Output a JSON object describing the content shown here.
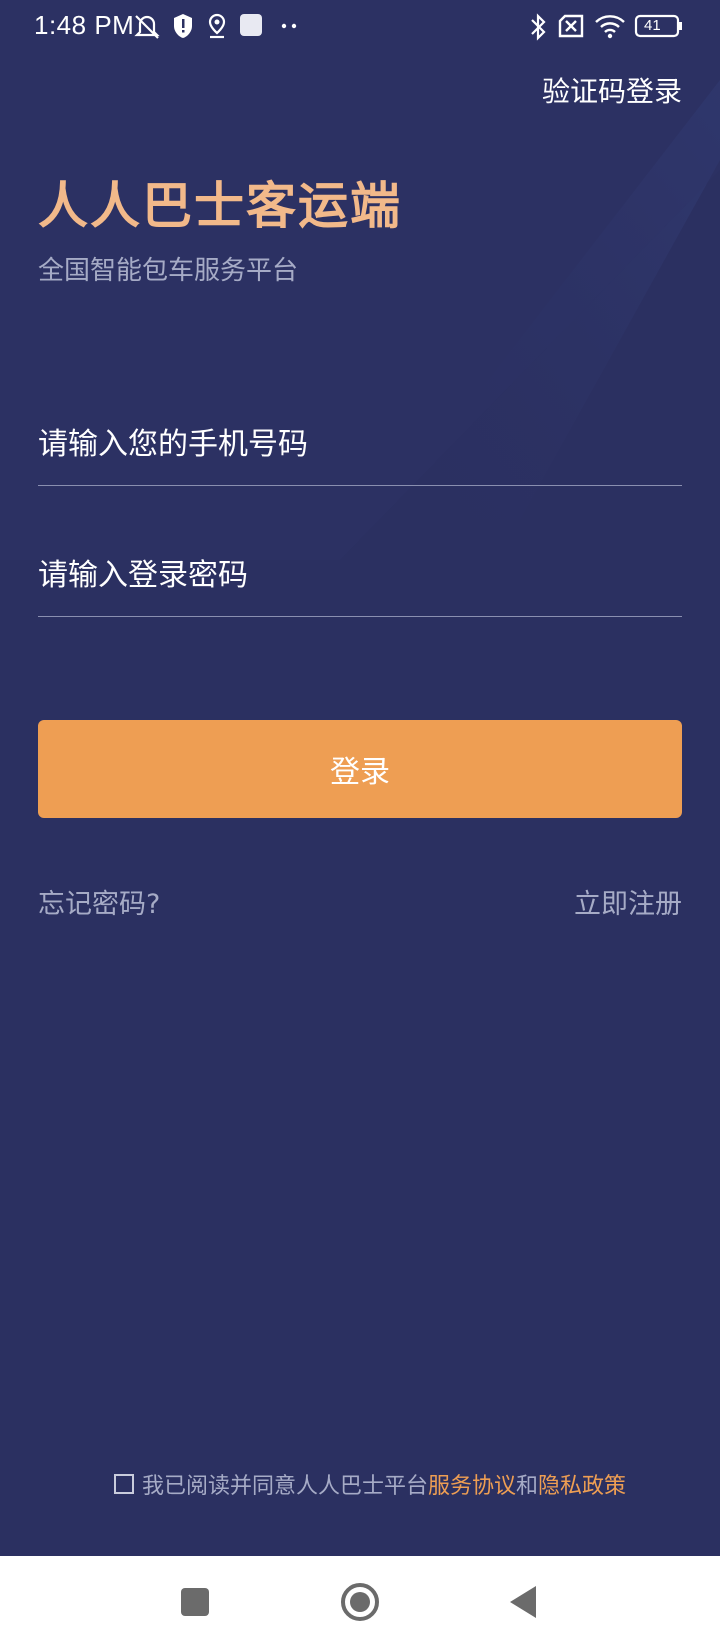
{
  "status_bar": {
    "time": "1:48 PM",
    "battery": "41",
    "icons": [
      "mute-icon",
      "shield-icon",
      "location-icon",
      "notification-square-icon",
      "more-dots-icon",
      "bluetooth-icon",
      "sim-off-icon",
      "wifi-icon",
      "battery-icon"
    ]
  },
  "header": {
    "sms_login_label": "验证码登录"
  },
  "app": {
    "title": "人人巴士客运端",
    "subtitle": "全国智能包车服务平台"
  },
  "form": {
    "phone_placeholder": "请输入您的手机号码",
    "password_placeholder": "请输入登录密码",
    "login_label": "登录"
  },
  "links": {
    "forgot_password": "忘记密码?",
    "register": "立即注册"
  },
  "agreement": {
    "prefix": "我已阅读并同意人人巴士平台",
    "service_agreement": "服务协议",
    "and": "和",
    "privacy_policy": "隐私政策",
    "checked": false
  },
  "nav": {
    "icons": [
      "recent-apps-icon",
      "home-icon",
      "back-icon"
    ]
  },
  "colors": {
    "background": "#2b3061",
    "accent": "#ee9e53",
    "title": "#f2b98a"
  }
}
